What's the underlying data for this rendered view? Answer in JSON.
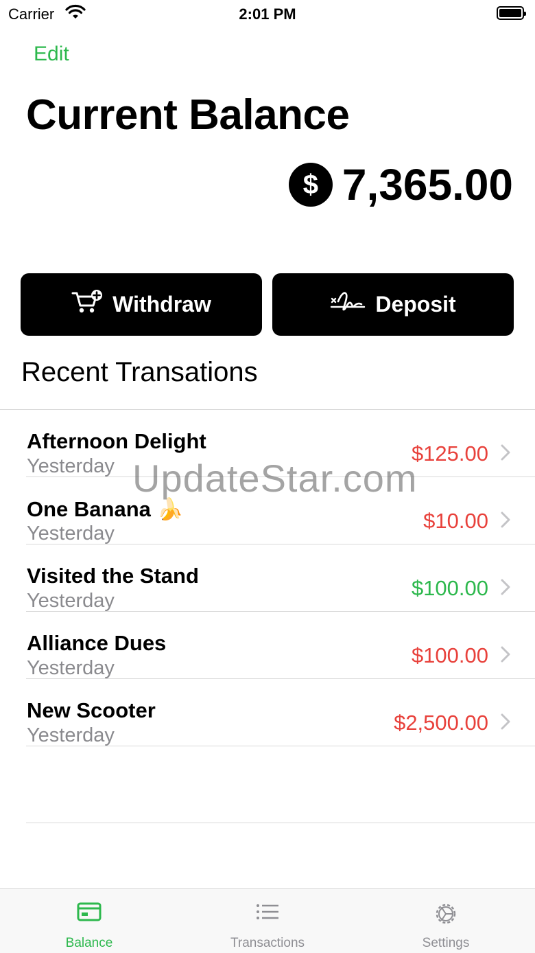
{
  "status_bar": {
    "carrier": "Carrier",
    "time": "2:01 PM"
  },
  "nav": {
    "edit_label": "Edit"
  },
  "title": "Current Balance",
  "balance": {
    "currency_icon": "dollar-circle-icon",
    "currency_symbol": "$",
    "amount": "7,365.00"
  },
  "actions": {
    "withdraw": {
      "label": "Withdraw",
      "icon": "cart-plus-icon"
    },
    "deposit": {
      "label": "Deposit",
      "icon": "signature-icon"
    }
  },
  "section_title": "Recent Transations",
  "transactions": [
    {
      "name": "Afternoon Delight",
      "date": "Yesterday",
      "amount": "$125.00",
      "kind": "withdraw"
    },
    {
      "name": "One Banana 🍌",
      "date": "Yesterday",
      "amount": "$10.00",
      "kind": "withdraw"
    },
    {
      "name": "Visited the Stand",
      "date": "Yesterday",
      "amount": "$100.00",
      "kind": "deposit"
    },
    {
      "name": "Alliance Dues",
      "date": "Yesterday",
      "amount": "$100.00",
      "kind": "withdraw"
    },
    {
      "name": "New Scooter",
      "date": "Yesterday",
      "amount": "$2,500.00",
      "kind": "withdraw"
    }
  ],
  "tabs": [
    {
      "label": "Balance",
      "icon": "card-icon",
      "active": true
    },
    {
      "label": "Transactions",
      "icon": "list-icon",
      "active": false
    },
    {
      "label": "Settings",
      "icon": "gear-icon",
      "active": false
    }
  ],
  "colors": {
    "accent": "#2db84d",
    "negative": "#e8413b",
    "positive": "#2db84d",
    "secondary_text": "#8a8a8e"
  },
  "watermark": "UpdateStar.com"
}
